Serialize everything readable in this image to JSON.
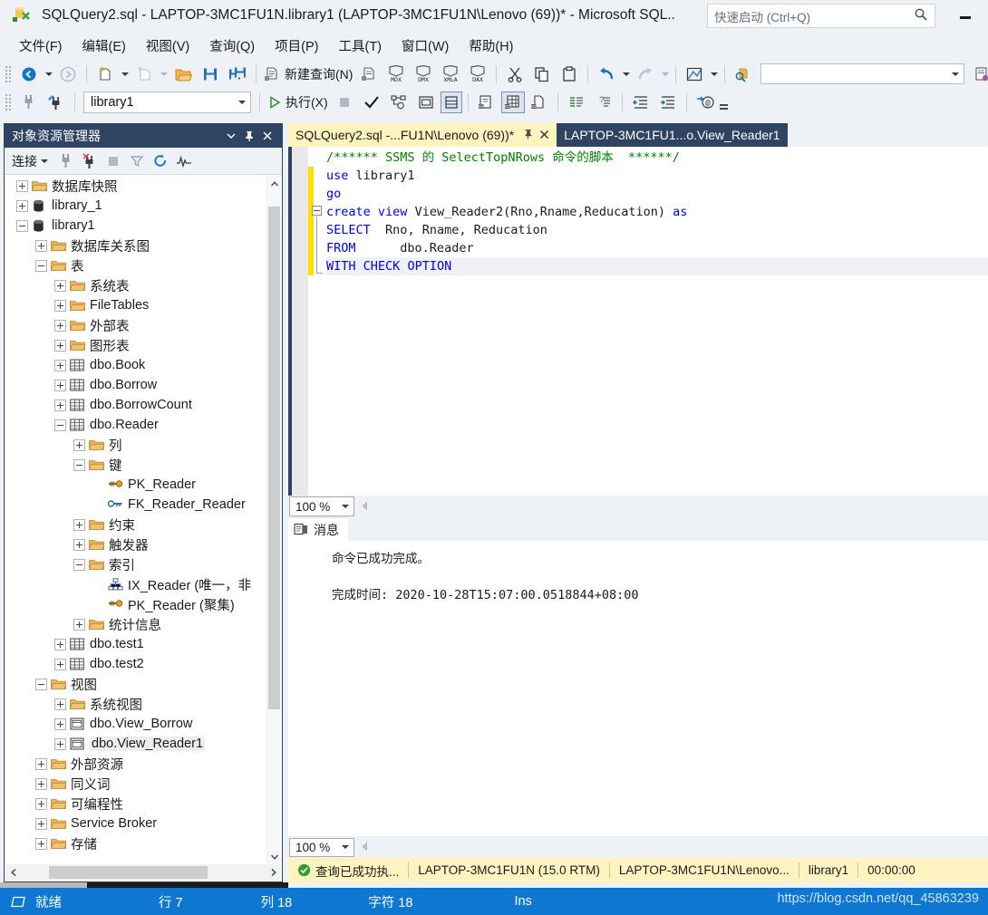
{
  "window": {
    "title": "SQLQuery2.sql - LAPTOP-3MC1FU1N.library1 (LAPTOP-3MC1FU1N\\Lenovo (69))* - Microsoft SQL...",
    "quick_launch_placeholder": "快速启动 (Ctrl+Q)",
    "minimize_label": "最小化"
  },
  "menu": {
    "items": [
      {
        "label": "文件(F)"
      },
      {
        "label": "编辑(E)"
      },
      {
        "label": "视图(V)"
      },
      {
        "label": "查询(Q)"
      },
      {
        "label": "项目(P)"
      },
      {
        "label": "工具(T)"
      },
      {
        "label": "窗口(W)"
      },
      {
        "label": "帮助(H)"
      }
    ]
  },
  "toolbar": {
    "new_query_label": "新建查询(N)",
    "execute_label": "执行(X)",
    "database_value": "library1",
    "blank_combo_value": ""
  },
  "object_explorer": {
    "title": "对象资源管理器",
    "connect_label": "连接",
    "tree": [
      {
        "label": "数据库快照",
        "depth": 1,
        "state": "plus",
        "icon": "folder-icon"
      },
      {
        "label": "library_1",
        "depth": 1,
        "state": "plus",
        "icon": "database-icon"
      },
      {
        "label": "library1",
        "depth": 1,
        "state": "minus",
        "icon": "database-icon"
      },
      {
        "label": "数据库关系图",
        "depth": 2,
        "state": "plus",
        "icon": "folder-icon"
      },
      {
        "label": "表",
        "depth": 2,
        "state": "minus",
        "icon": "folder-icon"
      },
      {
        "label": "系统表",
        "depth": 3,
        "state": "plus",
        "icon": "folder-icon"
      },
      {
        "label": "FileTables",
        "depth": 3,
        "state": "plus",
        "icon": "folder-icon"
      },
      {
        "label": "外部表",
        "depth": 3,
        "state": "plus",
        "icon": "folder-icon"
      },
      {
        "label": "图形表",
        "depth": 3,
        "state": "plus",
        "icon": "folder-icon"
      },
      {
        "label": "dbo.Book",
        "depth": 3,
        "state": "plus",
        "icon": "table-icon"
      },
      {
        "label": "dbo.Borrow",
        "depth": 3,
        "state": "plus",
        "icon": "table-icon"
      },
      {
        "label": "dbo.BorrowCount",
        "depth": 3,
        "state": "plus",
        "icon": "table-icon"
      },
      {
        "label": "dbo.Reader",
        "depth": 3,
        "state": "minus",
        "icon": "table-icon"
      },
      {
        "label": "列",
        "depth": 4,
        "state": "plus",
        "icon": "folder-icon"
      },
      {
        "label": "键",
        "depth": 4,
        "state": "minus",
        "icon": "folder-icon"
      },
      {
        "label": "PK_Reader",
        "depth": 5,
        "state": "none",
        "icon": "primary-key-icon"
      },
      {
        "label": "FK_Reader_Reader",
        "depth": 5,
        "state": "none",
        "icon": "foreign-key-icon"
      },
      {
        "label": "约束",
        "depth": 4,
        "state": "plus",
        "icon": "folder-icon"
      },
      {
        "label": "触发器",
        "depth": 4,
        "state": "plus",
        "icon": "folder-icon"
      },
      {
        "label": "索引",
        "depth": 4,
        "state": "minus",
        "icon": "folder-icon"
      },
      {
        "label": "IX_Reader (唯一，非",
        "depth": 5,
        "state": "none",
        "icon": "index-icon"
      },
      {
        "label": "PK_Reader (聚集)",
        "depth": 5,
        "state": "none",
        "icon": "primary-key-icon"
      },
      {
        "label": "统计信息",
        "depth": 4,
        "state": "plus",
        "icon": "folder-icon"
      },
      {
        "label": "dbo.test1",
        "depth": 3,
        "state": "plus",
        "icon": "table-icon"
      },
      {
        "label": "dbo.test2",
        "depth": 3,
        "state": "plus",
        "icon": "table-icon"
      },
      {
        "label": "视图",
        "depth": 2,
        "state": "minus",
        "icon": "folder-icon"
      },
      {
        "label": "系统视图",
        "depth": 3,
        "state": "plus",
        "icon": "folder-icon"
      },
      {
        "label": "dbo.View_Borrow",
        "depth": 3,
        "state": "plus",
        "icon": "view-icon"
      },
      {
        "label": "dbo.View_Reader1",
        "depth": 3,
        "state": "plus",
        "icon": "view-icon",
        "selected": true
      },
      {
        "label": "外部资源",
        "depth": 2,
        "state": "plus",
        "icon": "folder-icon"
      },
      {
        "label": "同义词",
        "depth": 2,
        "state": "plus",
        "icon": "folder-icon"
      },
      {
        "label": "可编程性",
        "depth": 2,
        "state": "plus",
        "icon": "folder-icon"
      },
      {
        "label": "Service Broker",
        "depth": 2,
        "state": "plus",
        "icon": "folder-icon"
      },
      {
        "label": "存储",
        "depth": 2,
        "state": "plus",
        "icon": "folder-icon"
      }
    ]
  },
  "editor": {
    "tabs": [
      {
        "label": "SQLQuery2.sql -...FU1N\\Lenovo (69))*",
        "active": true
      },
      {
        "label": "LAPTOP-3MC1FU1...o.View_Reader1",
        "active": false
      }
    ],
    "lines": [
      {
        "text": "/****** SSMS 的 SelectTopNRows 命令的脚本  ******/",
        "kind": "comment"
      },
      {
        "text": "use library1",
        "kind": "kw-first"
      },
      {
        "text": "go",
        "kind": "kw"
      },
      {
        "text": "create view View_Reader2(Rno,Rname,Reducation) as",
        "kind": "mixed"
      },
      {
        "text": "SELECT  Rno, Rname, Reducation",
        "kind": "mixed"
      },
      {
        "text": "FROM      dbo.Reader",
        "kind": "mixed"
      },
      {
        "text": "WITH CHECK OPTION",
        "kind": "kw"
      }
    ],
    "zoom_value": "100 %"
  },
  "results": {
    "tab_label": "消息",
    "message_line1": "命令已成功完成。",
    "message_line2": "完成时间: 2020-10-28T15:07:00.0518844+08:00",
    "zoom_value": "100 %"
  },
  "sql_status": {
    "query_status": "查询已成功执...",
    "server": "LAPTOP-3MC1FU1N (15.0 RTM)",
    "user": "LAPTOP-3MC1FU1N\\Lenovo...",
    "database": "library1",
    "elapsed": "00:00:00"
  },
  "vs_status": {
    "ready": "就绪",
    "line": "行 7",
    "column": "列 18",
    "char": "字符 18",
    "insert_mode": "Ins",
    "watermark": "https://blog.csdn.net/qq_45863239"
  },
  "colors": {
    "accent_blue": "#0d77d1",
    "panel_header": "#2f4463",
    "tab_active": "#fff3bf",
    "chrome": "#eef1f6",
    "keyword": "#0000ff",
    "comment": "#008000",
    "changebar": "#ffe100"
  }
}
